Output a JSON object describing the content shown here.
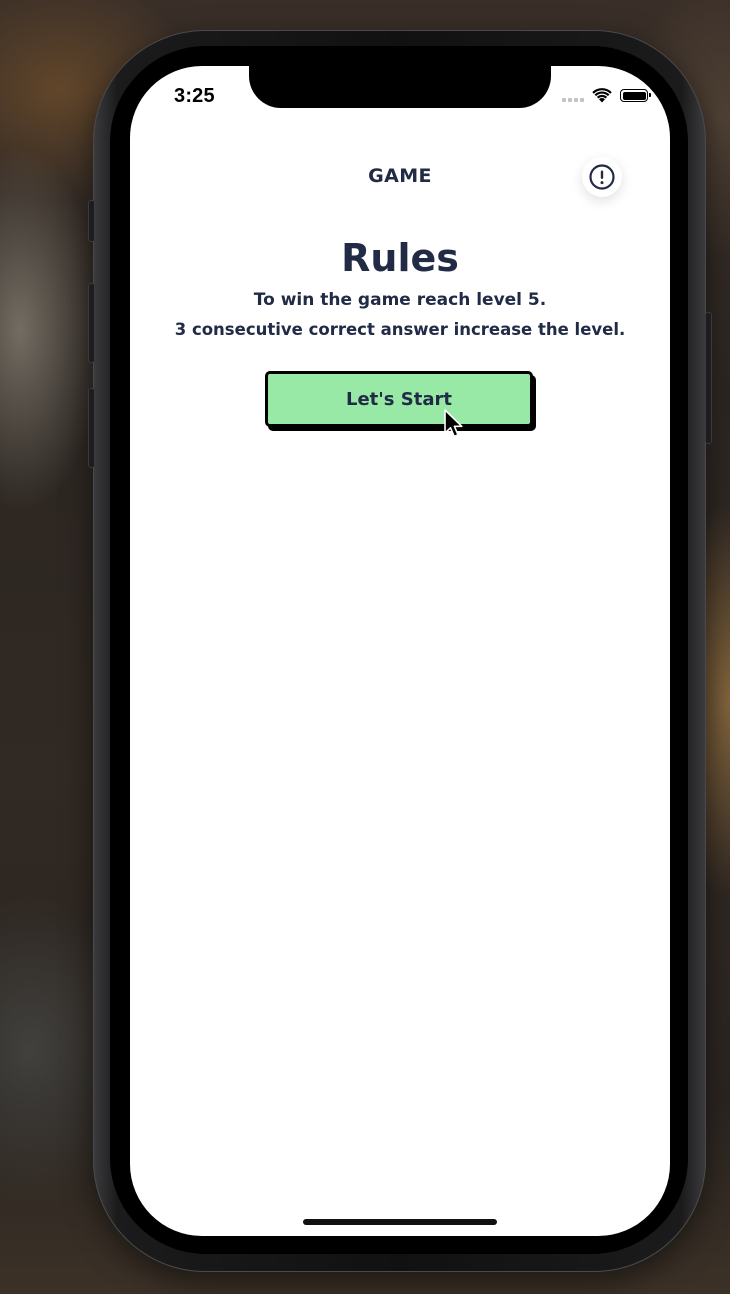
{
  "status_bar": {
    "time": "3:25",
    "signal_icon": "cellular-dots-icon",
    "wifi_icon": "wifi-icon",
    "battery_icon": "battery-icon",
    "battery_level": 1.0
  },
  "header": {
    "title": "GAME",
    "info_icon": "exclamation-circle-icon"
  },
  "rules": {
    "title": "Rules",
    "line1": "To win the game reach level 5.",
    "line2": "3 consecutive correct answer increase the level."
  },
  "start_button": {
    "label": "Let's Start"
  },
  "colors": {
    "text_dark": "#222b45",
    "button_green": "#98e8a6",
    "button_border": "#000000",
    "screen_bg": "#ffffff"
  }
}
